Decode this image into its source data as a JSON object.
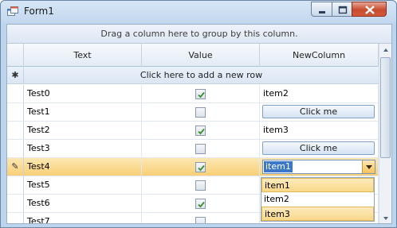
{
  "window": {
    "title": "Form1",
    "controls": {
      "minimize": "minimize",
      "maximize": "maximize",
      "close": "close"
    }
  },
  "grid": {
    "group_panel_text": "Drag a column here to group by this column.",
    "columns": [
      "Text",
      "Value",
      "NewColumn"
    ],
    "new_row_marker": "✱",
    "new_row_text": "Click here to add a new row",
    "rows": [
      {
        "text": "Test0",
        "checked": true,
        "new_column": {
          "kind": "text",
          "value": "item2"
        }
      },
      {
        "text": "Test1",
        "checked": false,
        "new_column": {
          "kind": "button",
          "value": "Click me"
        }
      },
      {
        "text": "Test2",
        "checked": true,
        "new_column": {
          "kind": "text",
          "value": "item3"
        }
      },
      {
        "text": "Test3",
        "checked": false,
        "new_column": {
          "kind": "button",
          "value": "Click me"
        }
      },
      {
        "text": "Test4",
        "checked": true,
        "new_column": {
          "kind": "combo",
          "value": "item1"
        },
        "current": true,
        "indicator": "✎"
      },
      {
        "text": "Test5",
        "checked": false,
        "new_column": {
          "kind": "empty",
          "value": ""
        }
      },
      {
        "text": "Test6",
        "checked": true,
        "new_column": {
          "kind": "empty",
          "value": ""
        }
      },
      {
        "text": "Test7",
        "checked": false,
        "new_column": {
          "kind": "empty",
          "value": ""
        }
      }
    ],
    "dropdown": {
      "items": [
        "item1",
        "item2",
        "item3"
      ],
      "highlighted": [
        "item1",
        "item3"
      ]
    }
  },
  "colors": {
    "selection": "#3c78c8",
    "current_row": "#f8cf76",
    "check": "#3a8f2e"
  }
}
